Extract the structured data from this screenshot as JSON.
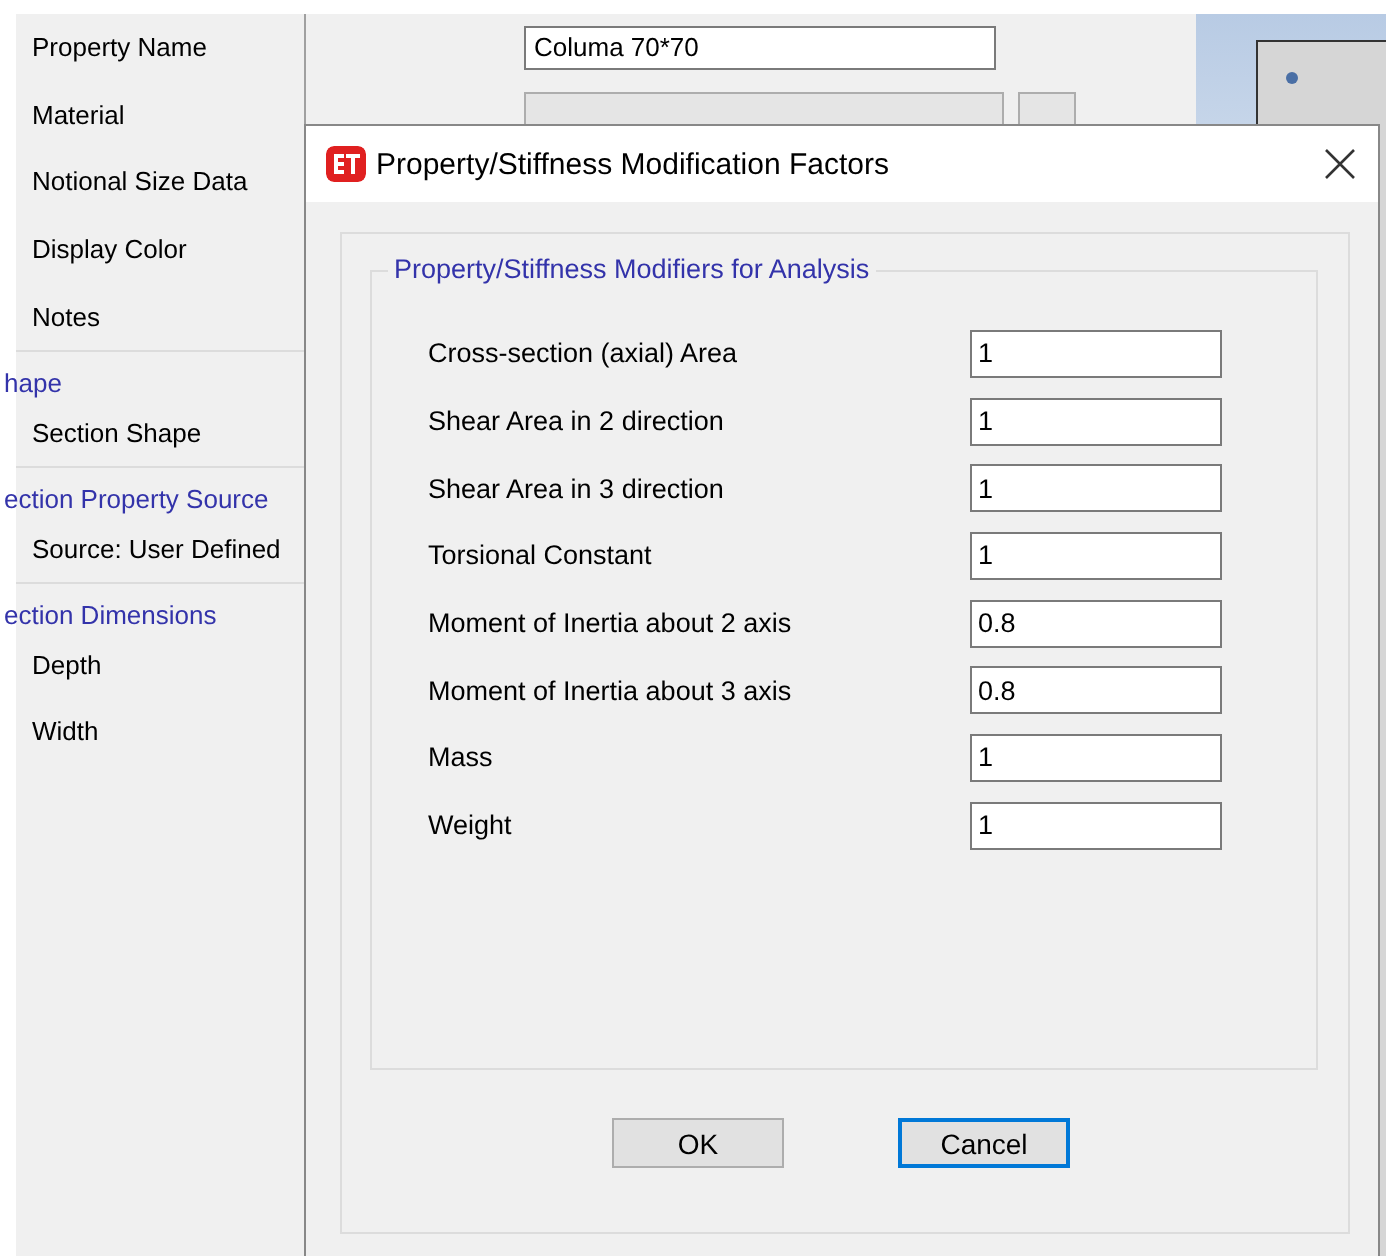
{
  "background_form": {
    "rows": [
      {
        "label": "Property Name",
        "kind": "text",
        "value": "Columa 70*70"
      },
      {
        "label": "Material",
        "kind": "dropdown"
      },
      {
        "label": "Notional Size Data",
        "kind": "plain"
      },
      {
        "label": "Display Color",
        "kind": "plain"
      },
      {
        "label": "Notes",
        "kind": "plain"
      }
    ],
    "sections": [
      {
        "heading": "hape",
        "items": [
          "Section Shape"
        ]
      },
      {
        "heading": "ection Property Source",
        "items": [
          "Source:  User Defined"
        ]
      },
      {
        "heading": "ection Dimensions",
        "items": [
          "Depth",
          "Width"
        ]
      }
    ]
  },
  "dialog": {
    "title": "Property/Stiffness Modification Factors",
    "group_title": "Property/Stiffness Modifiers for Analysis",
    "fields": [
      {
        "label": "Cross-section (axial) Area",
        "value": "1"
      },
      {
        "label": "Shear Area in 2 direction",
        "value": "1"
      },
      {
        "label": "Shear Area in 3 direction",
        "value": "1"
      },
      {
        "label": "Torsional Constant",
        "value": "1"
      },
      {
        "label": "Moment of Inertia about 2 axis",
        "value": "0.8"
      },
      {
        "label": "Moment of Inertia about 3 axis",
        "value": "0.8"
      },
      {
        "label": "Mass",
        "value": "1"
      },
      {
        "label": "Weight",
        "value": "1"
      }
    ],
    "buttons": [
      {
        "label": "OK",
        "selected": false
      },
      {
        "label": "Cancel",
        "selected": true
      }
    ]
  }
}
